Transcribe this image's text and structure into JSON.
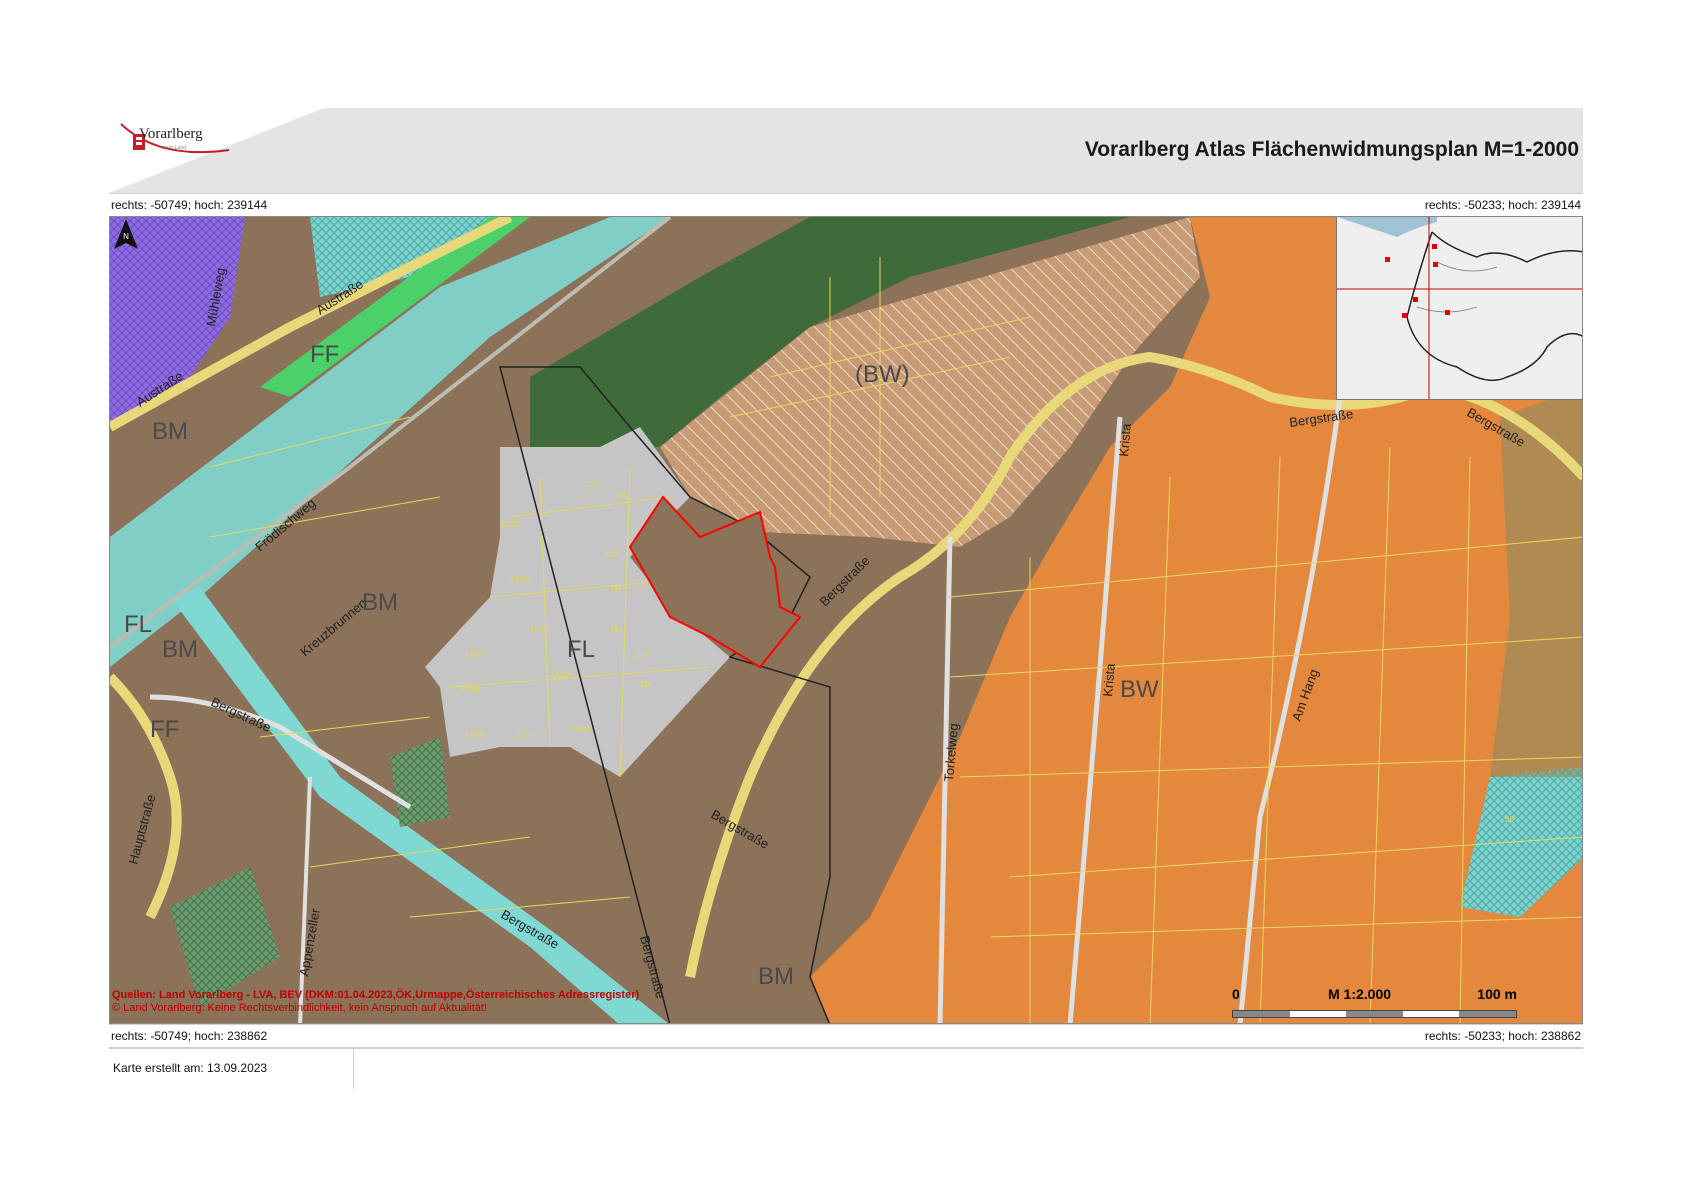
{
  "header": {
    "logo_name": "Vorarlberg",
    "logo_subtitle": "unser Land",
    "title": "Vorarlberg Atlas Flächenwidmungsplan M=1-2000"
  },
  "coords": {
    "top_left": "rechts: -50749; hoch: 239144",
    "top_right": "rechts: -50233; hoch: 239144",
    "bottom_left": "rechts: -50749; hoch: 238862",
    "bottom_right": "rechts: -50233; hoch: 238862"
  },
  "map": {
    "streets": {
      "muehleweg": "Mühleweg",
      "austrasse_1": "Austraße",
      "austrasse_2": "Austraße",
      "froedischweg": "Frödischweg",
      "kreuzbrunnen": "Kreuzbrunnen",
      "bergstrasse_1": "Bergstraße",
      "bergstrasse_2": "Bergstraße",
      "bergstrasse_3": "Bergstraße",
      "bergstrasse_4": "Bergstraße",
      "bergstrasse_5": "Bergstraße",
      "bergstrasse_6": "Bergstraße",
      "bergstrasse_7": "Bergstraße",
      "hauptstrasse": "Hauptstraße",
      "appenzeller": "Appenzeller",
      "torkelweg": "Torkelweg",
      "krista_1": "Krista",
      "krista_2": "Krista",
      "am_hang": "Am Hang"
    },
    "zones": {
      "ff": "FF",
      "bm_1": "BM",
      "bm_2": "BM",
      "bm_3": "BM",
      "bm_4": "BM",
      "fl_small": "FL",
      "fl": "FL",
      "ff_small": "FF",
      "bw_planned": "(BW)",
      "bw": "BW"
    },
    "parcels": {
      "p1": "110",
      "p2": "109",
      "p3": "133/5",
      "p4": "133/6",
      "p5": "110",
      "p6": "111",
      "p7": "133/2",
      "p8": "112",
      "p9": "133/1",
      "p10": "133/3",
      "p11": "113",
      "p12": "133/9",
      "p13": "114",
      "p14": "133/3",
      "p15": "133/5",
      "p16": "133/4",
      "p17": "36"
    },
    "colors": {
      "bw": "#e8893b",
      "bm": "#8b7259",
      "fl": "#c5c5c5",
      "forest": "#3f6b3a",
      "green": "#4cd06a",
      "river": "#7fd8d2",
      "purple": "#8e6be0",
      "parcel_lines": "#e6d95a",
      "selected": "#ff0000"
    }
  },
  "sources": {
    "line1": "Quellen: Land Vorarlberg - LVA, BEV (DKM:01.04.2023,ÖK,Urmappe,Österreichisches Adressregister)",
    "line2": "© Land Vorarlberg: Keine Rechtsverbindlichkeit, kein Anspruch auf Aktualität!"
  },
  "scale_bar": {
    "start": "0",
    "label": "M 1:2.000",
    "end": "100 m"
  },
  "north_arrow": {
    "label": "N",
    "icon": "north-arrow-icon"
  },
  "footer": {
    "date_text": "Karte erstellt am: 13.09.2023"
  }
}
